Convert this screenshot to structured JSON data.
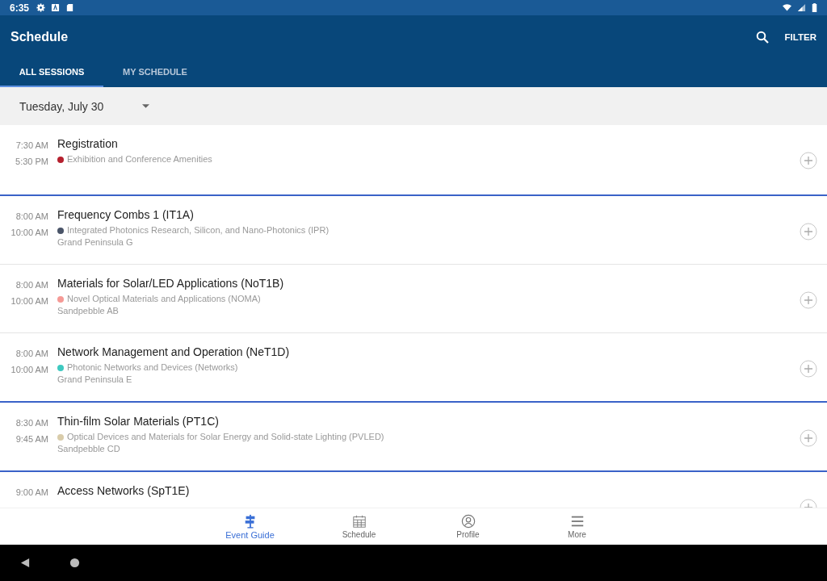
{
  "status_bar": {
    "time": "6:35"
  },
  "app_bar": {
    "title": "Schedule",
    "filter": "FILTER"
  },
  "tabs": [
    {
      "label": "ALL SESSIONS",
      "selected": true
    },
    {
      "label": "MY SCHEDULE",
      "selected": false
    }
  ],
  "date_picker": {
    "value": "Tuesday, July 30"
  },
  "sessions": [
    {
      "start": "7:30 AM",
      "end": "5:30 PM",
      "title": "Registration",
      "track": "Exhibition and Conference Amenities",
      "color": "#b5202e"
    },
    {
      "start": "8:00 AM",
      "end": "10:00 AM",
      "title": "Frequency Combs 1 (IT1A)",
      "track": "Integrated Photonics Research, Silicon, and Nano-Photonics (IPR)",
      "room": "Grand Peninsula G",
      "color": "#4a5468",
      "new_time_block": true
    },
    {
      "start": "8:00 AM",
      "end": "10:00 AM",
      "title": "Materials for Solar/LED Applications (NoT1B)",
      "track": "Novel Optical Materials and Applications (NOMA)",
      "room": "Sandpebble AB",
      "color": "#f59a96",
      "new_time_block": false
    },
    {
      "start": "8:00 AM",
      "end": "10:00 AM",
      "title": "Network Management and Operation (NeT1D)",
      "track": "Photonic Networks and Devices (Networks)",
      "room": "Grand Peninsula E",
      "color": "#3ec9c0",
      "new_time_block": false
    },
    {
      "start": "8:30 AM",
      "end": "9:45 AM",
      "title": "Thin-film Solar Materials (PT1C)",
      "track": "Optical Devices and Materials for Solar Energy and Solid-state Lighting (PVLED)",
      "room": "Sandpebble CD",
      "color": "#d9ccaa",
      "new_time_block": true
    },
    {
      "start": "9:00 AM",
      "title": "Access Networks (SpT1E)",
      "new_time_block": true
    }
  ],
  "bottom_nav": [
    {
      "label": "Event Guide",
      "kind": "signpost",
      "selected": true
    },
    {
      "label": "Schedule",
      "kind": "calendar",
      "selected": false
    },
    {
      "label": "Profile",
      "kind": "profile",
      "selected": false
    },
    {
      "label": "More",
      "kind": "menu",
      "selected": false
    }
  ]
}
